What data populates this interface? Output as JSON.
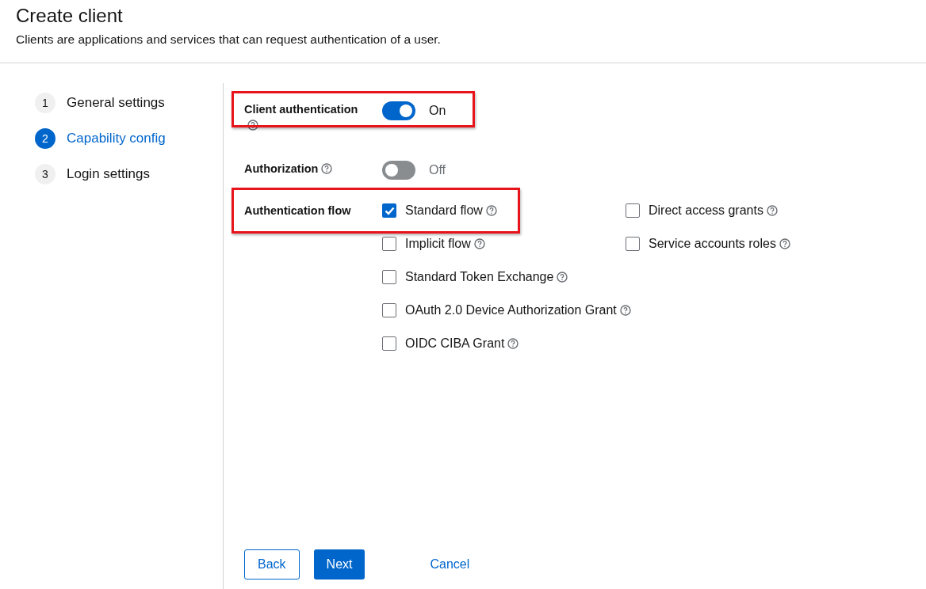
{
  "header": {
    "title": "Create client",
    "subtitle": "Clients are applications and services that can request authentication of a user."
  },
  "steps": [
    {
      "number": "1",
      "label": "General settings",
      "selected": false
    },
    {
      "number": "2",
      "label": "Capability config",
      "selected": true
    },
    {
      "number": "3",
      "label": "Login settings",
      "selected": false
    }
  ],
  "fields": [
    {
      "kind": "switch",
      "label": "Client authentication",
      "on": true,
      "state_label": "On",
      "highlighted": true,
      "help": true
    },
    {
      "kind": "switch",
      "label": "Authorization",
      "on": false,
      "state_label": "Off",
      "highlighted": false,
      "help": true
    },
    {
      "kind": "checkboxes",
      "label": "Authentication flow",
      "highlighted": true,
      "help": false,
      "columns": [
        [
          {
            "label": "Standard flow",
            "checked": true
          },
          {
            "label": "Implicit flow",
            "checked": false
          },
          {
            "label": "Standard Token Exchange",
            "checked": false
          },
          {
            "label": "OAuth 2.0 Device Authorization Grant",
            "checked": false
          },
          {
            "label": "OIDC CIBA Grant",
            "checked": false
          }
        ],
        [
          {
            "label": "Direct access grants",
            "checked": false
          },
          {
            "label": "Service accounts roles",
            "checked": false
          }
        ]
      ]
    }
  ],
  "buttons": [
    {
      "label": "Back",
      "kind": "secondary"
    },
    {
      "label": "Next",
      "kind": "primary"
    },
    {
      "label": "Cancel",
      "kind": "link"
    }
  ]
}
